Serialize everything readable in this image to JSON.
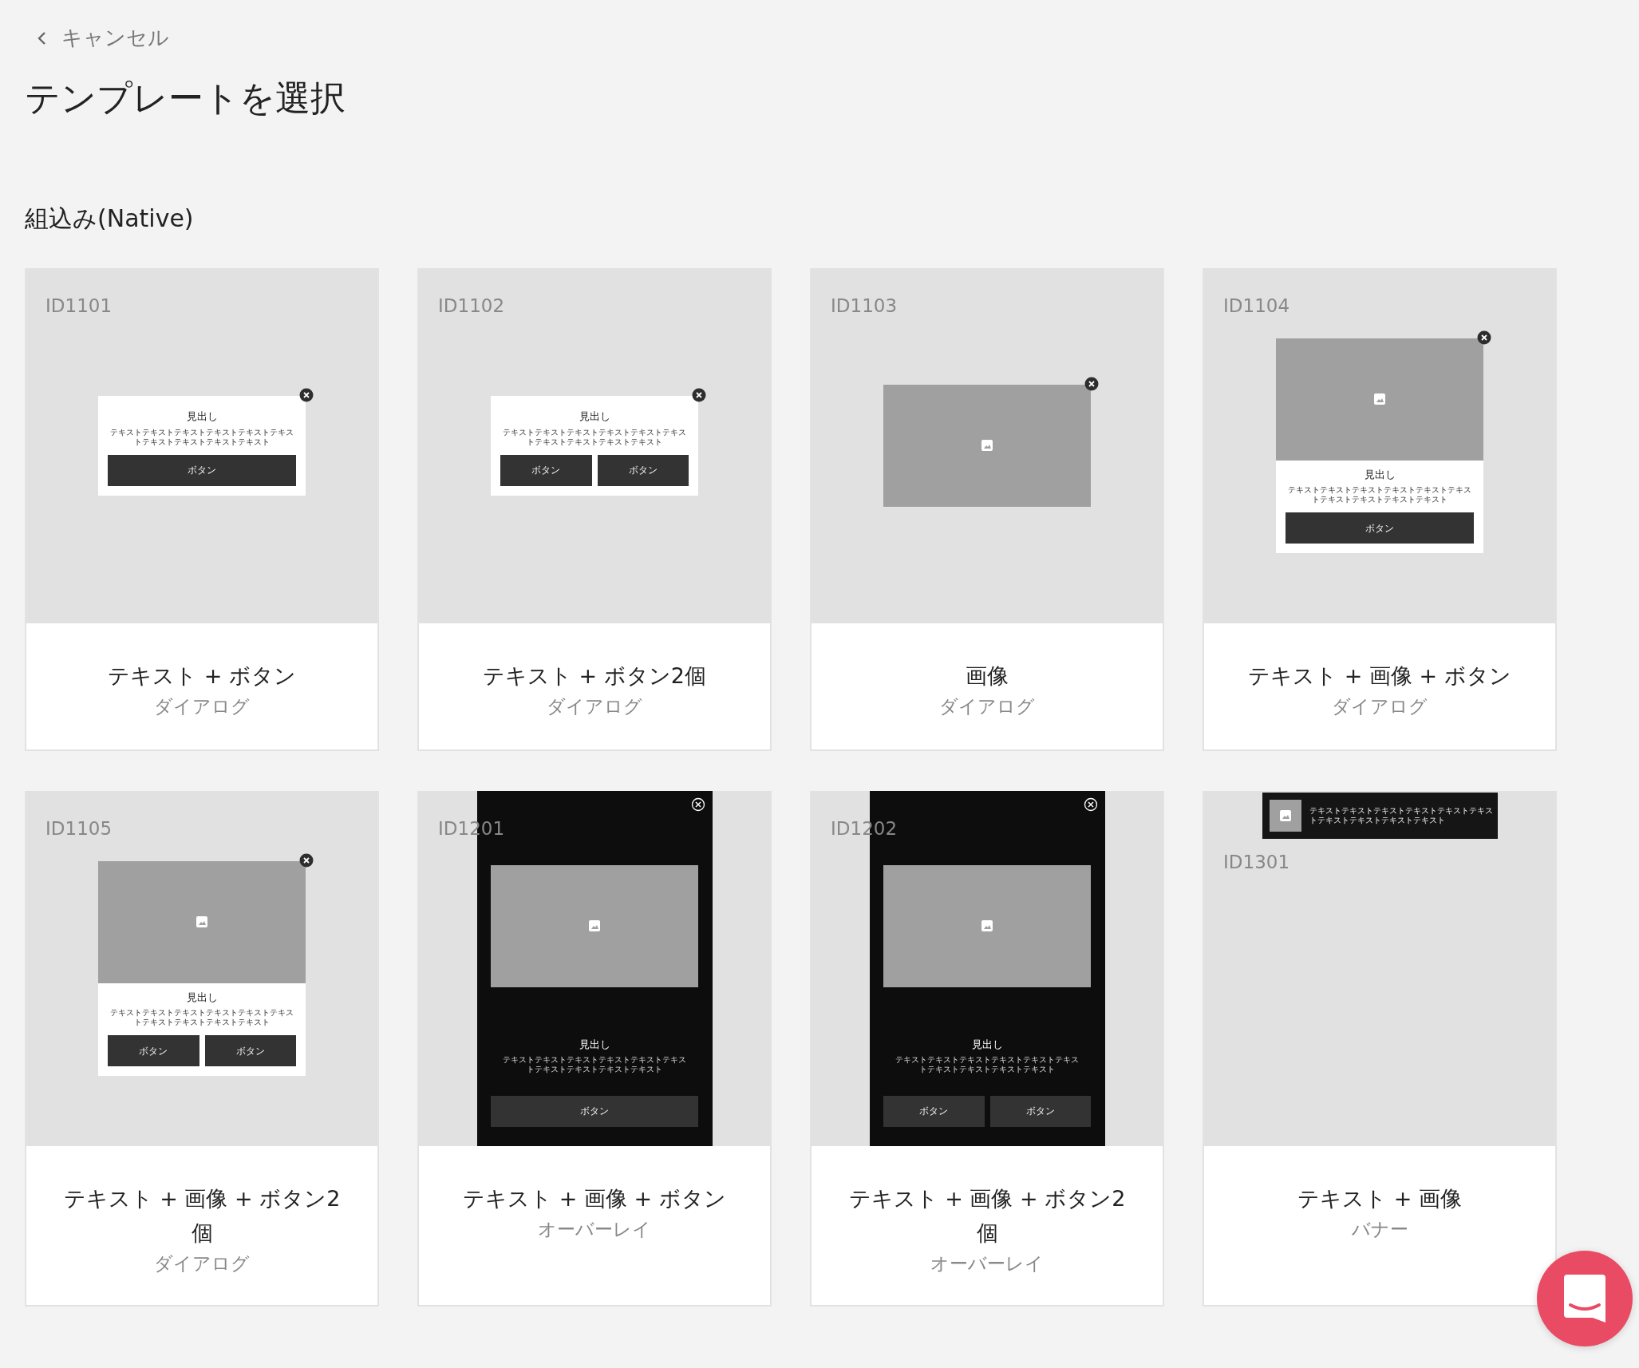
{
  "header": {
    "back_label": "キャンセル",
    "title": "テンプレートを選択"
  },
  "section": {
    "title": "組込み(Native)",
    "templates": [
      {
        "id": "ID1101",
        "name": "テキスト + ボタン",
        "type": "ダイアログ",
        "preview": {
          "kind": "dialog",
          "image": false,
          "close": true,
          "heading": "見出し",
          "text": "テキストテキストテキストテキストテキストテキストテキストテキストテキストテキスト",
          "buttons": [
            "ボタン"
          ]
        }
      },
      {
        "id": "ID1102",
        "name": "テキスト + ボタン2個",
        "type": "ダイアログ",
        "preview": {
          "kind": "dialog",
          "image": false,
          "close": true,
          "heading": "見出し",
          "text": "テキストテキストテキストテキストテキストテキストテキストテキストテキストテキスト",
          "buttons": [
            "ボタン",
            "ボタン"
          ]
        }
      },
      {
        "id": "ID1103",
        "name": "画像",
        "type": "ダイアログ",
        "preview": {
          "kind": "image",
          "image": true,
          "close": true
        }
      },
      {
        "id": "ID1104",
        "name": "テキスト + 画像 + ボタン",
        "type": "ダイアログ",
        "preview": {
          "kind": "dialog",
          "image": true,
          "close": true,
          "heading": "見出し",
          "text": "テキストテキストテキストテキストテキストテキストテキストテキストテキストテキスト",
          "buttons": [
            "ボタン"
          ]
        }
      },
      {
        "id": "ID1105",
        "name": "テキスト + 画像 + ボタン2個",
        "type": "ダイアログ",
        "preview": {
          "kind": "dialog",
          "image": true,
          "close": true,
          "heading": "見出し",
          "text": "テキストテキストテキストテキストテキストテキストテキストテキストテキストテキスト",
          "buttons": [
            "ボタン",
            "ボタン"
          ]
        }
      },
      {
        "id": "ID1201",
        "name": "テキスト + 画像 + ボタン",
        "type": "オーバーレイ",
        "preview": {
          "kind": "overlay",
          "image": true,
          "close": true,
          "heading": "見出し",
          "text": "テキストテキストテキストテキストテキストテキストテキストテキストテキストテキスト",
          "buttons": [
            "ボタン"
          ]
        }
      },
      {
        "id": "ID1202",
        "name": "テキスト + 画像 + ボタン2個",
        "type": "オーバーレイ",
        "preview": {
          "kind": "overlay",
          "image": true,
          "close": true,
          "heading": "見出し",
          "text": "テキストテキストテキストテキストテキストテキストテキストテキストテキストテキスト",
          "buttons": [
            "ボタン",
            "ボタン"
          ]
        }
      },
      {
        "id": "ID1301",
        "name": "テキスト + 画像",
        "type": "バナー",
        "preview": {
          "kind": "banner",
          "image": true,
          "close": false,
          "text": "テキストテキストテキストテキストテキストテキストテキストテキストテキストテキスト"
        }
      }
    ]
  }
}
